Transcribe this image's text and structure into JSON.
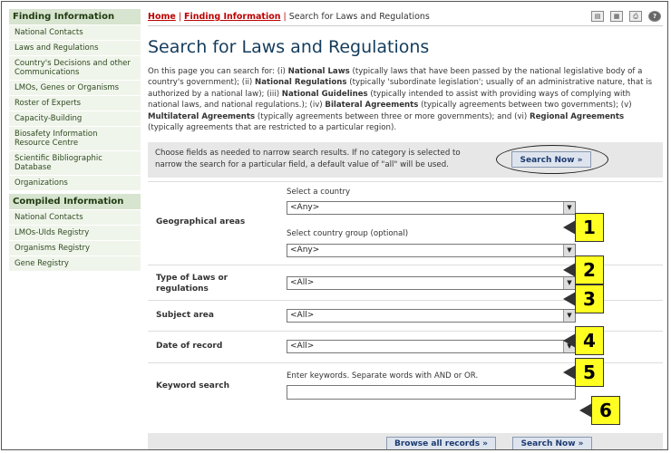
{
  "sidebar": {
    "finding_title": "Finding Information",
    "finding_items": [
      {
        "label": "National Contacts"
      },
      {
        "label": "Laws and Regulations"
      },
      {
        "label": "Country's Decisions and other Communications"
      },
      {
        "label": "LMOs, Genes or Organisms"
      },
      {
        "label": "Roster of Experts"
      },
      {
        "label": "Capacity-Building"
      },
      {
        "label": "Biosafety Information Resource Centre"
      },
      {
        "label": "Scientific Bibliographic Database"
      },
      {
        "label": "Organizations"
      }
    ],
    "compiled_title": "Compiled Information",
    "compiled_items": [
      {
        "label": "National Contacts"
      },
      {
        "label": "LMOs-UIds Registry"
      },
      {
        "label": "Organisms Registry"
      },
      {
        "label": "Gene Registry"
      }
    ]
  },
  "breadcrumb": {
    "home": "Home",
    "section": "Finding Information",
    "current": "Search for Laws and Regulations",
    "sep": "|"
  },
  "toolbar_icons": [
    "print-version-icon",
    "export-icon",
    "print-icon",
    "help-icon"
  ],
  "page_title": "Search for Laws and Regulations",
  "intro": {
    "p1": "On this page you can search for: (i) ",
    "b1": "National Laws",
    "p2": " (typically laws that have been passed by the national legislative body of a country's government); (ii) ",
    "b2": "National Regulations",
    "p3": " (typically 'subordinate legislation'; usually of an administrative nature, that is authorized by a national law); (iii) ",
    "b3": "National Guidelines",
    "p4": " (typically intended to assist with providing ways of complying with national laws, and national regulations.); (iv) ",
    "b4": "Bilateral Agreements",
    "p5": " (typically agreements between two governments); (v) ",
    "b5": "Multilateral Agreements",
    "p6": " (typically agreements between three or more governments); and (vi) ",
    "b6": "Regional Agreements",
    "p7": " (typically agreements that are restricted to a particular region)."
  },
  "hint": "Choose fields as needed to narrow search results. If no category is selected to narrow the search for a particular field, a default value of \"all\" will be used.",
  "buttons": {
    "search_now": "Search Now »",
    "browse_all": "Browse all records »",
    "search_now_bottom": "Search Now »"
  },
  "form": {
    "geo_label": "Geographical areas",
    "country_label": "Select a country",
    "country_value": "<Any>",
    "group_label": "Select country group (optional)",
    "group_value": "<Any>",
    "type_label_1": "Type of Laws or",
    "type_label_2": "regulations",
    "type_value": "<All>",
    "subject_label": "Subject area",
    "subject_value": "<All>",
    "date_label": "Date of record",
    "date_value": "<All>",
    "keyword_label": "Keyword search",
    "keyword_hint": "Enter keywords. Separate words with AND or OR.",
    "keyword_value": ""
  },
  "callouts": [
    "1",
    "2",
    "3",
    "4",
    "5",
    "6"
  ],
  "colors": {
    "callout": "#ffff22",
    "title": "#143c5c",
    "link": "#b00000",
    "sidebar_head": "#d7e4cf"
  }
}
